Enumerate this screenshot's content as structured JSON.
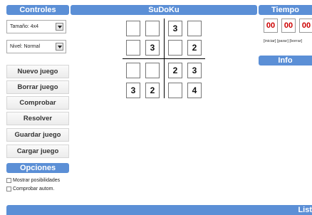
{
  "left": {
    "header": "Controles",
    "size_select": "Tamaño: 4x4",
    "level_select": "Nivel: Normal",
    "buttons": [
      "Nuevo juego",
      "Borrar juego",
      "Comprobar",
      "Resolver",
      "Guardar juego",
      "Cargar juego"
    ],
    "options_header": "Opciones",
    "options": [
      "Mostrar posibilidades",
      "Comprobar autom."
    ]
  },
  "center": {
    "header": "SuDoKu",
    "grid": [
      [
        "",
        "",
        "3",
        ""
      ],
      [
        "",
        "3",
        "",
        "2"
      ],
      [
        "",
        "",
        "2",
        "3"
      ],
      [
        "3",
        "2",
        "",
        "4"
      ]
    ]
  },
  "right": {
    "header": "Tiempo",
    "timer": [
      "00",
      "00",
      "00"
    ],
    "links": [
      "[iniciar]",
      "[parar]",
      "[borrar]"
    ],
    "info_header": "Info"
  },
  "bottom": {
    "header": "List"
  }
}
